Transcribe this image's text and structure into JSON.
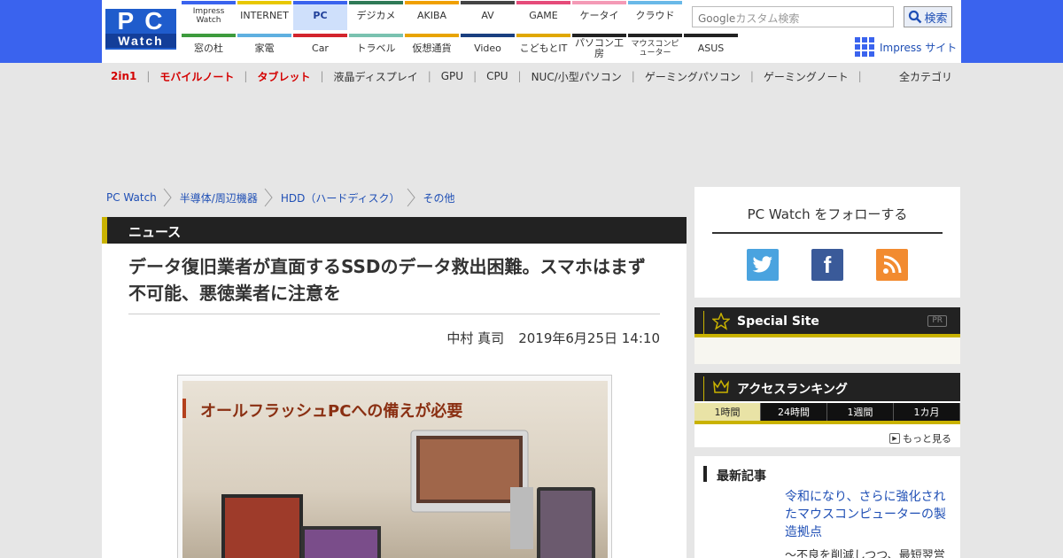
{
  "logo": {
    "line1": "PC",
    "line2": "Watch"
  },
  "nav": {
    "row1": [
      {
        "label": "Impress Watch",
        "color": "#3a63ee"
      },
      {
        "label": "INTERNET",
        "color": "#e8c800"
      },
      {
        "label": "PC",
        "color": "#3a63ee",
        "active": true
      },
      {
        "label": "デジカメ",
        "color": "#2f7a57"
      },
      {
        "label": "AKIBA",
        "color": "#f0a000"
      },
      {
        "label": "AV",
        "color": "#444444"
      },
      {
        "label": "GAME",
        "color": "#e64b7a"
      },
      {
        "label": "ケータイ",
        "color": "#f49ab6"
      },
      {
        "label": "クラウド",
        "color": "#69b9e8"
      }
    ],
    "row2": [
      {
        "label": "窓の杜",
        "color": "#3d9b3d"
      },
      {
        "label": "家電",
        "color": "#5fb0e0"
      },
      {
        "label": "Car",
        "color": "#d3242d"
      },
      {
        "label": "トラベル",
        "color": "#7ac2b0"
      },
      {
        "label": "仮想通貨",
        "color": "#e8a400"
      },
      {
        "label": "Video",
        "color": "#1a3f80"
      },
      {
        "label": "こどもとIT",
        "color": "#e0a800"
      },
      {
        "label": "パソコン工房",
        "color": "#222222"
      },
      {
        "label": "マウスコンピューター",
        "color": "#222222"
      },
      {
        "label": "ASUS",
        "color": "#222222"
      }
    ]
  },
  "search": {
    "placeholder": "カスタム検索",
    "brand": "Google",
    "button": "検索"
  },
  "impress_link": "Impress サイト",
  "categories": [
    {
      "label": "2in1",
      "highlight": true
    },
    {
      "label": "モバイルノート",
      "highlight": true
    },
    {
      "label": "タブレット",
      "highlight": true
    },
    {
      "label": "液晶ディスプレイ"
    },
    {
      "label": "GPU"
    },
    {
      "label": "CPU"
    },
    {
      "label": "NUC/小型パソコン"
    },
    {
      "label": "ゲーミングパソコン"
    },
    {
      "label": "ゲーミングノート"
    }
  ],
  "all_categories": "全カテゴリ",
  "breadcrumb": [
    "PC Watch",
    "半導体/周辺機器",
    "HDD（ハードディスク）",
    "その他"
  ],
  "section_label": "ニュース",
  "article": {
    "title": "データ復旧業者が直面するSSDのデータ救出困難。スマホはまず不可能、悪徳業者に注意を",
    "author": "中村 真司",
    "date": "2019年6月25日 14:10",
    "photo_text": "オールフラッシュPCへの備えが必要"
  },
  "follow": {
    "heading": "PC Watch をフォローする"
  },
  "special_site": {
    "title": "Special Site",
    "badge": "PR"
  },
  "ranking": {
    "title": "アクセスランキング",
    "tabs": [
      "1時間",
      "24時間",
      "1週間",
      "1カ月"
    ],
    "more": "もっと見る"
  },
  "latest": {
    "heading": "最新記事",
    "article_title": "令和になり、さらに強化されたマウスコンピューターの製造拠点",
    "article_sub": "～不良を削減しつつ、最短翌営"
  }
}
